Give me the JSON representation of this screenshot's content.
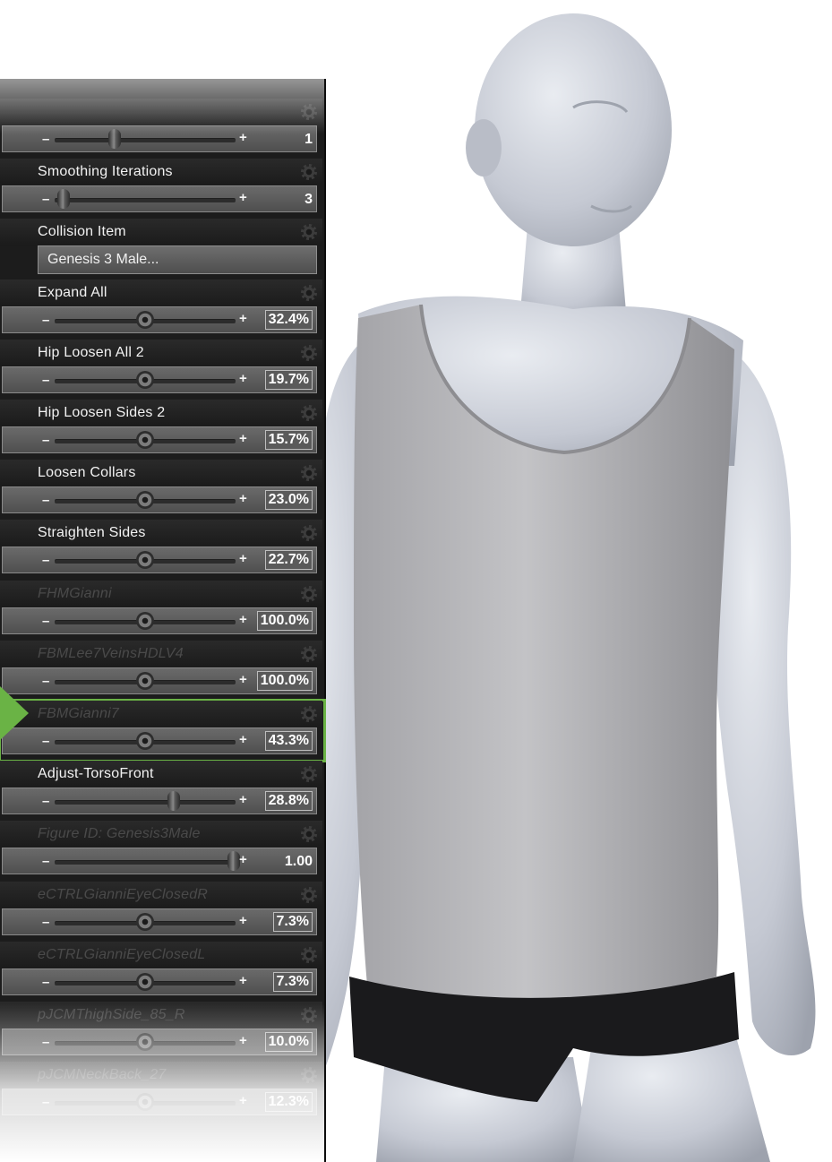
{
  "parameters": [
    {
      "label": "",
      "value": "1",
      "fraction": 0.33,
      "knob": "oval",
      "dim": true
    },
    {
      "label": "Smoothing Iterations",
      "value": "3",
      "fraction": 0.05,
      "knob": "oval"
    },
    {
      "label": "Collision Item",
      "dropdown": "Genesis 3 Male..."
    },
    {
      "label": "Expand All",
      "value": "32.4%",
      "fraction": 0.5
    },
    {
      "label": "Hip Loosen All 2",
      "value": "19.7%",
      "fraction": 0.5
    },
    {
      "label": "Hip Loosen Sides 2",
      "value": "15.7%",
      "fraction": 0.5
    },
    {
      "label": "Loosen Collars",
      "value": "23.0%",
      "fraction": 0.5
    },
    {
      "label": "Straighten Sides",
      "value": "22.7%",
      "fraction": 0.5
    },
    {
      "label": "FHMGianni",
      "value": "100.0%",
      "fraction": 0.5,
      "dim": true
    },
    {
      "label": "FBMLee7VeinsHDLV4",
      "value": "100.0%",
      "fraction": 0.5,
      "dim": true
    },
    {
      "label": "FBMGianni7",
      "value": "43.3%",
      "fraction": 0.5,
      "dim": true,
      "selected": true
    },
    {
      "label": "Adjust-TorsoFront",
      "value": "28.8%",
      "fraction": 0.66,
      "knob": "oval"
    },
    {
      "label": "Figure ID: Genesis3Male",
      "value": "1.00",
      "fraction": 0.99,
      "knob": "oval",
      "dim": true
    },
    {
      "label": "eCTRLGianniEyeClosedR",
      "value": "7.3%",
      "fraction": 0.5,
      "dim": true
    },
    {
      "label": "eCTRLGianniEyeClosedL",
      "value": "7.3%",
      "fraction": 0.5,
      "dim": true
    },
    {
      "label": "pJCMThighSide_85_R",
      "value": "10.0%",
      "fraction": 0.5,
      "dim": true
    },
    {
      "label": "pJCMNeckBack_27",
      "value": "12.3%",
      "fraction": 0.5,
      "dim": true
    }
  ],
  "colors": {
    "accent": "#6ab345",
    "panel": "#1c1c1c",
    "skin": "#c9cdd6",
    "shirt": "#b0b0b3",
    "shorts": "#1a1a1c"
  }
}
